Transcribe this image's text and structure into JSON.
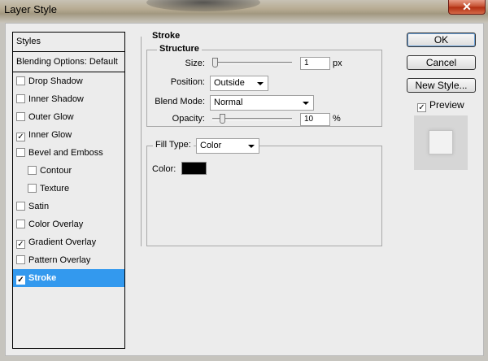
{
  "window": {
    "title": "Layer Style",
    "close_glyph": "✕"
  },
  "styles": {
    "header": "Styles",
    "blending": "Blending Options: Default",
    "items": [
      {
        "label": "Drop Shadow",
        "checked": false
      },
      {
        "label": "Inner Shadow",
        "checked": false
      },
      {
        "label": "Outer Glow",
        "checked": false
      },
      {
        "label": "Inner Glow",
        "checked": true
      },
      {
        "label": "Bevel and Emboss",
        "checked": false
      },
      {
        "label": "Contour",
        "checked": false,
        "indent": true
      },
      {
        "label": "Texture",
        "checked": false,
        "indent": true
      },
      {
        "label": "Satin",
        "checked": false
      },
      {
        "label": "Color Overlay",
        "checked": false
      },
      {
        "label": "Gradient Overlay",
        "checked": true
      },
      {
        "label": "Pattern Overlay",
        "checked": false
      },
      {
        "label": "Stroke",
        "checked": true,
        "selected": true
      }
    ]
  },
  "stroke": {
    "title": "Stroke",
    "structure": {
      "title": "Structure",
      "size_label": "Size:",
      "size_value": "1",
      "size_unit": "px",
      "size_fraction": 0.0,
      "position_label": "Position:",
      "position_value": "Outside",
      "blend_label": "Blend Mode:",
      "blend_value": "Normal",
      "opacity_label": "Opacity:",
      "opacity_value": "10",
      "opacity_unit": "%",
      "opacity_fraction": 0.1
    },
    "fill": {
      "type_label": "Fill Type:",
      "type_value": "Color",
      "color_label": "Color:",
      "color": "#000000"
    }
  },
  "buttons": {
    "ok": "OK",
    "cancel": "Cancel",
    "new_style": "New Style..."
  },
  "preview": {
    "label": "Preview",
    "checked": true
  }
}
